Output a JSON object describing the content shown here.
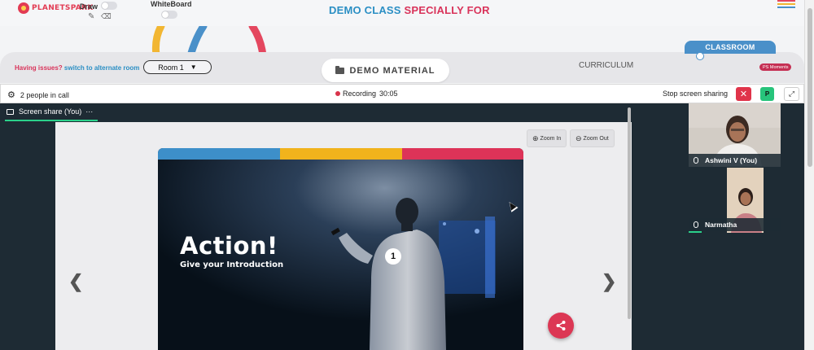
{
  "header": {
    "logo_text": "PLANETSPARK",
    "draw_label": "Draw",
    "whiteboard_label": "WhiteBoard",
    "title_part1": "DEMO CLASS",
    "title_part2": "SPECIALLY FOR",
    "colors": {
      "blue": "#2b8fc4",
      "red": "#d9335a",
      "menu_stripes": [
        "#e4475f",
        "#f2b632",
        "#4a90c9"
      ]
    }
  },
  "room_bar": {
    "issues_text": "Having issues?",
    "alternate_link": "switch to alternate room",
    "room_select_value": "Room 1",
    "demo_material_button": "DEMO MATERIAL",
    "curriculum_label": "CURRICULUM",
    "classroom_tab": "CLASSROOM",
    "ps_moments_badge": "PS Moments"
  },
  "call_bar": {
    "people_count": "2 people in call",
    "recording_label": "Recording",
    "recording_time": "30:05",
    "stop_sharing_label": "Stop screen sharing",
    "stop_icon": "✕",
    "participant_initial": "P",
    "expand_icon": "⤢"
  },
  "screen_share": {
    "tab_label": "Screen share (You)",
    "more_icon": "···",
    "zoom_in_label": "Zoom In",
    "zoom_out_label": "Zoom Out",
    "prev_icon": "❮",
    "next_icon": "❯"
  },
  "slide": {
    "title": "Action!",
    "subtitle": "Give your Introduction",
    "badge_number": "1",
    "stripe_colors": [
      "#3d8fc9",
      "#f1b31c",
      "#dd3358"
    ]
  },
  "participants": [
    {
      "name": "Ashwini V (You)"
    },
    {
      "name": "Narmatha"
    }
  ]
}
